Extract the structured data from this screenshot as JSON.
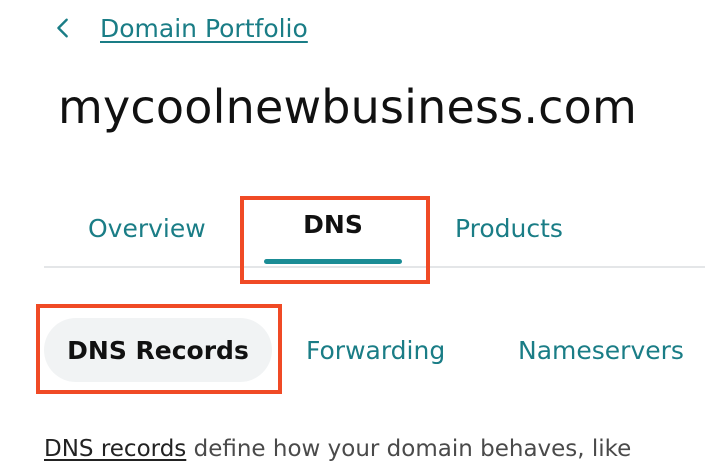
{
  "breadcrumb": {
    "back_icon": "chevron-left-icon",
    "label": "Domain Portfolio"
  },
  "page": {
    "title": "mycoolnewbusiness.com"
  },
  "tabs": [
    {
      "label": "Overview",
      "active": false
    },
    {
      "label": "DNS",
      "active": true
    },
    {
      "label": "Products",
      "active": false
    }
  ],
  "subtabs": [
    {
      "label": "DNS Records",
      "active": true
    },
    {
      "label": "Forwarding",
      "active": false
    },
    {
      "label": "Nameservers",
      "active": false
    }
  ],
  "description": {
    "link_text": "DNS records",
    "text": " define how your domain behaves, like"
  },
  "colors": {
    "link": "#1a7d86",
    "tab_indicator": "#1a8c95",
    "highlight": "#f04a25",
    "subtab_active_bg": "#f1f3f4"
  }
}
